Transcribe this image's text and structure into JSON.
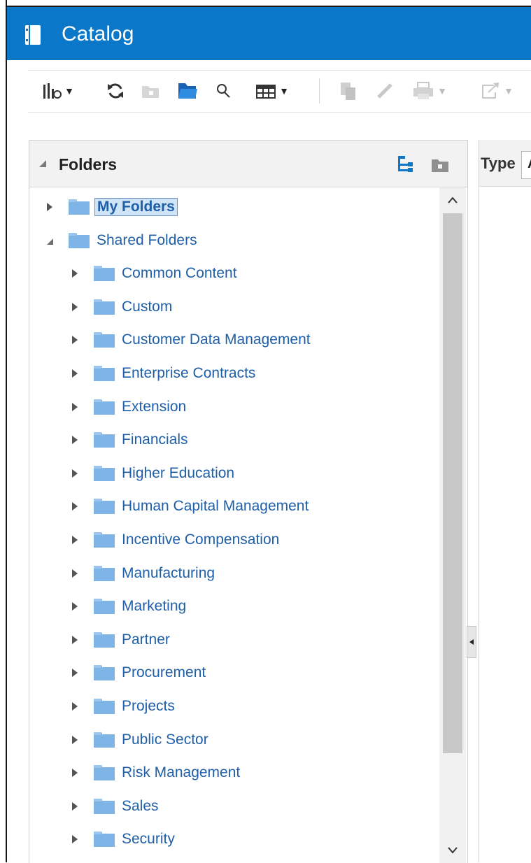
{
  "header": {
    "title": "Catalog",
    "icon": "catalog-icon"
  },
  "toolbar": {
    "buttons": [
      {
        "name": "view-options-button",
        "icon": "view-options-icon",
        "has_menu": true,
        "enabled": true
      },
      {
        "name": "refresh-button",
        "icon": "refresh-icon",
        "has_menu": false,
        "enabled": true
      },
      {
        "name": "new-folder-button",
        "icon": "new-folder-icon",
        "has_menu": false,
        "enabled": false
      },
      {
        "name": "open-folder-button",
        "icon": "folder-open-icon",
        "has_menu": false,
        "enabled": true
      },
      {
        "name": "search-button",
        "icon": "search-icon",
        "has_menu": false,
        "enabled": true
      },
      {
        "name": "columns-button",
        "icon": "table-icon",
        "has_menu": true,
        "enabled": true
      },
      {
        "name": "copy-button",
        "icon": "copy-icon",
        "has_menu": false,
        "enabled": false
      },
      {
        "name": "edit-button",
        "icon": "pencil-icon",
        "has_menu": false,
        "enabled": false
      },
      {
        "name": "print-button",
        "icon": "print-icon",
        "has_menu": true,
        "enabled": false
      },
      {
        "name": "share-button",
        "icon": "share-icon",
        "has_menu": true,
        "enabled": false
      }
    ]
  },
  "folders_panel": {
    "title": "Folders",
    "tree": [
      {
        "label": "My Folders",
        "level": 0,
        "expanded": false,
        "selected": true
      },
      {
        "label": "Shared Folders",
        "level": 0,
        "expanded": true,
        "selected": false
      },
      {
        "label": "Common Content",
        "level": 1,
        "expanded": false
      },
      {
        "label": "Custom",
        "level": 1,
        "expanded": false
      },
      {
        "label": "Customer Data Management",
        "level": 1,
        "expanded": false
      },
      {
        "label": "Enterprise Contracts",
        "level": 1,
        "expanded": false
      },
      {
        "label": "Extension",
        "level": 1,
        "expanded": false
      },
      {
        "label": "Financials",
        "level": 1,
        "expanded": false
      },
      {
        "label": "Higher Education",
        "level": 1,
        "expanded": false
      },
      {
        "label": "Human Capital Management",
        "level": 1,
        "expanded": false
      },
      {
        "label": "Incentive Compensation",
        "level": 1,
        "expanded": false
      },
      {
        "label": "Manufacturing",
        "level": 1,
        "expanded": false
      },
      {
        "label": "Marketing",
        "level": 1,
        "expanded": false
      },
      {
        "label": "Partner",
        "level": 1,
        "expanded": false
      },
      {
        "label": "Procurement",
        "level": 1,
        "expanded": false
      },
      {
        "label": "Projects",
        "level": 1,
        "expanded": false
      },
      {
        "label": "Public Sector",
        "level": 1,
        "expanded": false
      },
      {
        "label": "Risk Management",
        "level": 1,
        "expanded": false
      },
      {
        "label": "Sales",
        "level": 1,
        "expanded": false
      },
      {
        "label": "Security",
        "level": 1,
        "expanded": false
      }
    ]
  },
  "right_panel": {
    "type_label": "Type",
    "type_value": "A"
  },
  "colors": {
    "header_bg": "#0a77c8",
    "link": "#1f5fa8",
    "folder": "#7fb5e6"
  }
}
